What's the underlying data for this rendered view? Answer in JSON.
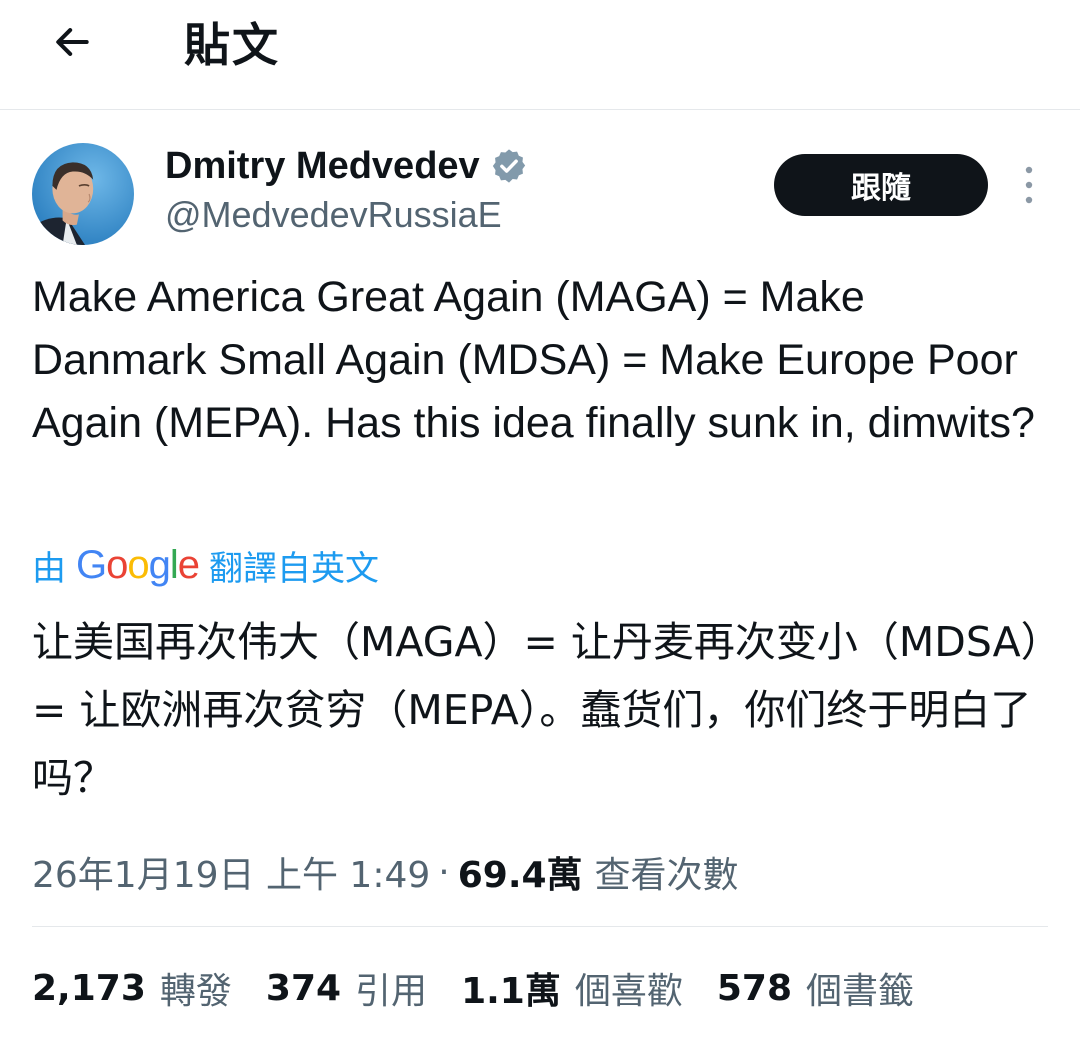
{
  "header": {
    "title": "貼文",
    "back_icon": "arrow-left-icon"
  },
  "author": {
    "name": "Dmitry Medvedev",
    "handle": "@MedvedevRussiaE",
    "verified_icon": "verified-badge-icon",
    "verified_color": "#829aab"
  },
  "actions": {
    "follow_label": "跟隨",
    "more_icon": "more-vertical-icon"
  },
  "tweet": {
    "text": "Make America Great Again (MAGA) = Make Danmark Small Again (MDSA) = Make Europe Poor Again (MEPA). Has this idea finally sunk in, dimwits?",
    "translation_prefix": "由",
    "translation_brand": "Google",
    "translation_suffix": "翻譯自英文",
    "translated_text": "让美国再次伟大（MAGA）= 让丹麦再次变小（MDSA）= 让欧洲再次贫穷（MEPA）。蠢货们，你们终于明白了吗？"
  },
  "meta": {
    "timestamp": "26年1月19日 上午 1:49",
    "separator": "·",
    "views_count": "69.4萬",
    "views_label": "查看次數"
  },
  "stats": [
    {
      "count": "2,173",
      "label": "轉發"
    },
    {
      "count": "374",
      "label": "引用"
    },
    {
      "count": "1.1萬",
      "label": "個喜歡"
    },
    {
      "count": "578",
      "label": "個書籤"
    }
  ],
  "colors": {
    "text_primary": "#0f1419",
    "text_secondary": "#536471",
    "link_blue": "#1d9bf0",
    "follow_bg": "#0f1419",
    "divider": "#e5e8eb"
  }
}
